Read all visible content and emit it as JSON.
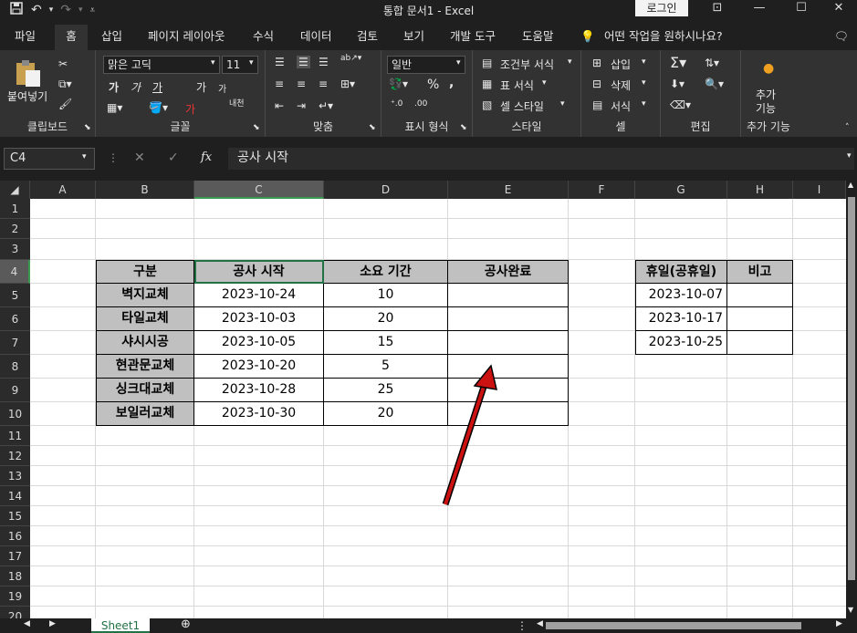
{
  "window": {
    "title": "통합 문서1  -  Excel",
    "login_label": "로그인"
  },
  "tabs": [
    "파일",
    "홈",
    "삽입",
    "페이지 레이아웃",
    "수식",
    "데이터",
    "검토",
    "보기",
    "개발 도구",
    "도움말"
  ],
  "tell_me": "어떤 작업을 원하시나요?",
  "ribbon": {
    "clipboard": {
      "paste": "붙여넣기",
      "label": "클립보드"
    },
    "font": {
      "name": "맑은 고딕",
      "size": "11",
      "label": "글꼴",
      "bold": "가",
      "italic": "가",
      "underline": "가",
      "grow": "가",
      "shrink": "가",
      "color_a": "가",
      "phonetic": "내천"
    },
    "alignment": {
      "label": "맞춤"
    },
    "number": {
      "format": "일반",
      "percent": "%",
      "comma": ",",
      "label": "표시 형식"
    },
    "styles": {
      "conditional": "조건부 서식",
      "table": "표 서식",
      "cell": "셀 스타일",
      "label": "스타일"
    },
    "cells": {
      "insert": "삽입",
      "delete": "삭제",
      "format": "서식",
      "label": "셀"
    },
    "editing": {
      "label": "편집"
    },
    "addins": {
      "button": "추가\n기능",
      "label": "추가 기능"
    }
  },
  "formula_bar": {
    "name_box": "C4",
    "fx": "fx",
    "content": "공사 시작"
  },
  "columns": [
    "A",
    "B",
    "C",
    "D",
    "E",
    "F",
    "G",
    "H",
    "I"
  ],
  "rows": [
    "1",
    "2",
    "3",
    "4",
    "5",
    "6",
    "7",
    "8",
    "9",
    "10",
    "11",
    "12",
    "13",
    "14",
    "15",
    "16",
    "17",
    "18",
    "19",
    "20"
  ],
  "table_main": {
    "headers": [
      "구분",
      "공사 시작",
      "소요 기간",
      "공사완료"
    ],
    "rows": [
      [
        "벽지교체",
        "2023-10-24",
        "10",
        ""
      ],
      [
        "타일교체",
        "2023-10-03",
        "20",
        ""
      ],
      [
        "샤시시공",
        "2023-10-05",
        "15",
        ""
      ],
      [
        "현관문교체",
        "2023-10-20",
        "5",
        ""
      ],
      [
        "싱크대교체",
        "2023-10-28",
        "25",
        ""
      ],
      [
        "보일러교체",
        "2023-10-30",
        "20",
        ""
      ]
    ]
  },
  "table_holidays": {
    "headers": [
      "휴일(공휴일)",
      "비고"
    ],
    "rows": [
      [
        "2023-10-07",
        ""
      ],
      [
        "2023-10-17",
        ""
      ],
      [
        "2023-10-25",
        ""
      ]
    ]
  },
  "sheet": {
    "tab": "Sheet1"
  },
  "colors": {
    "header_fill": "#c0c0c0",
    "selection": "#3a9a50",
    "arrow": "#cc1111"
  }
}
